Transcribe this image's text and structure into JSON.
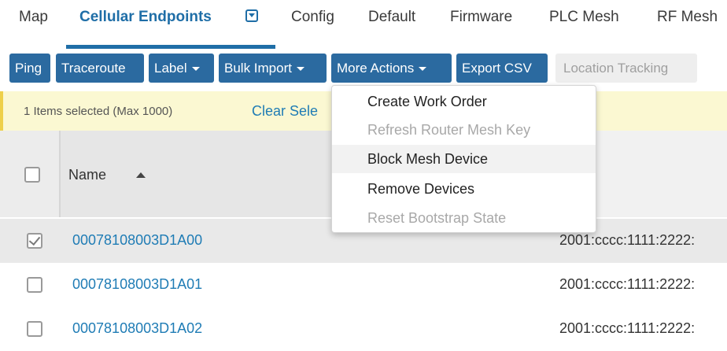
{
  "tabs": [
    {
      "label": "Map"
    },
    {
      "label": "Cellular Endpoints"
    },
    {
      "label": "Config"
    },
    {
      "label": "Default"
    },
    {
      "label": "Firmware"
    },
    {
      "label": "PLC Mesh"
    },
    {
      "label": "RF Mesh"
    }
  ],
  "toolbar": {
    "ping": "Ping",
    "traceroute": "Traceroute",
    "label": "Label",
    "bulk_import": "Bulk Import",
    "more_actions": "More Actions",
    "export_csv": "Export CSV",
    "location_tracking": "Location Tracking"
  },
  "selection": {
    "count_text": "1 Items selected (Max 1000)",
    "clear_text": "Clear Sele"
  },
  "table": {
    "header": {
      "name": "Name"
    },
    "rows": [
      {
        "id": "00078108003D1A00",
        "ip": "2001:cccc:1111:2222:",
        "checked": true
      },
      {
        "id": "00078108003D1A01",
        "ip": "2001:cccc:1111:2222:",
        "checked": false
      },
      {
        "id": "00078108003D1A02",
        "ip": "2001:cccc:1111:2222:",
        "checked": false
      }
    ]
  },
  "more_actions_menu": {
    "items": [
      {
        "label": "Create Work Order",
        "disabled": false
      },
      {
        "label": "Refresh Router Mesh Key",
        "disabled": true
      },
      {
        "label": "Block Mesh Device",
        "disabled": false,
        "hovered": true
      },
      {
        "label": "Remove Devices",
        "disabled": false
      },
      {
        "label": "Reset Bootstrap State",
        "disabled": true
      }
    ]
  },
  "colors": {
    "accent": "#1f6ea7",
    "button_bg": "#2b6aa0",
    "link": "#1f7cb5",
    "selection_bar_bg": "#fbf8d2",
    "selection_bar_border": "#eed04a"
  }
}
